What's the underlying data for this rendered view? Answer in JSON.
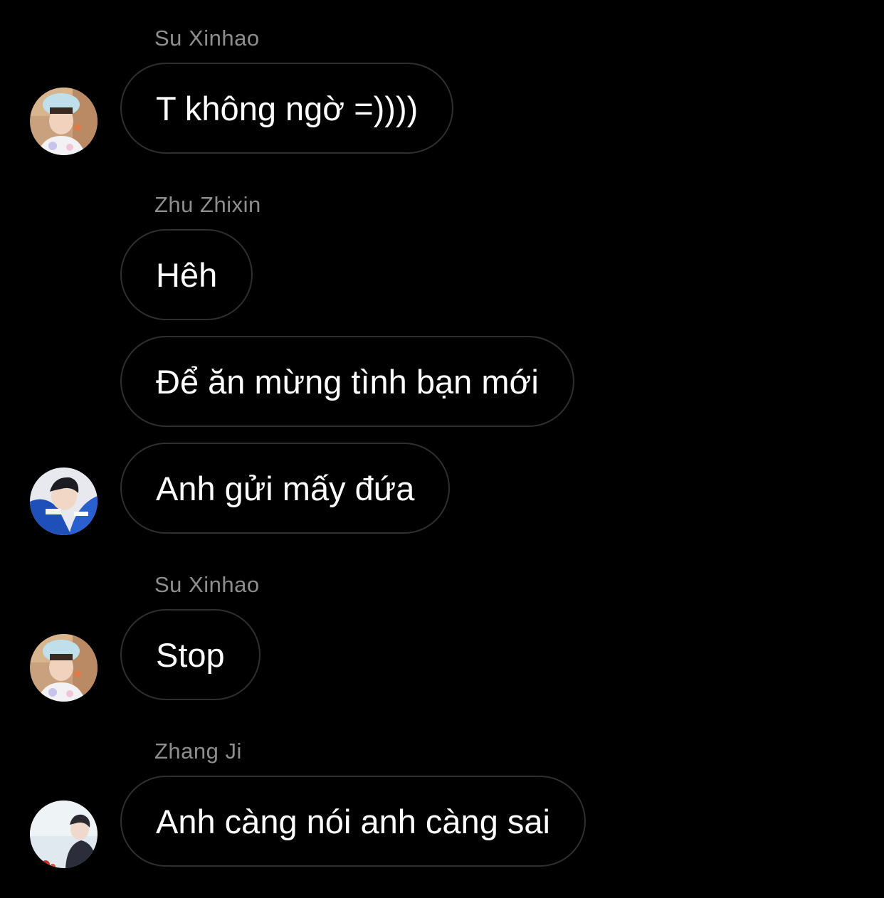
{
  "colors": {
    "background": "#000000",
    "bubble_border": "#2f2f2f",
    "sender_name": "#8e8e8e",
    "message_text": "#ffffff"
  },
  "messages": [
    {
      "sender": "Su Xinhao",
      "text": "T không ngờ =))))",
      "avatar": "su-xinhao-avatar"
    },
    {
      "sender": "Zhu Zhixin",
      "text": "Hêh"
    },
    {
      "text": "Để ăn mừng tình bạn mới"
    },
    {
      "text": "Anh gửi mấy đứa",
      "avatar": "zhu-zhixin-avatar"
    },
    {
      "sender": "Su Xinhao",
      "text": "Stop",
      "avatar": "su-xinhao-avatar"
    },
    {
      "sender": "Zhang Ji",
      "text": "Anh càng nói anh càng sai",
      "avatar": "zhang-ji-avatar"
    }
  ]
}
